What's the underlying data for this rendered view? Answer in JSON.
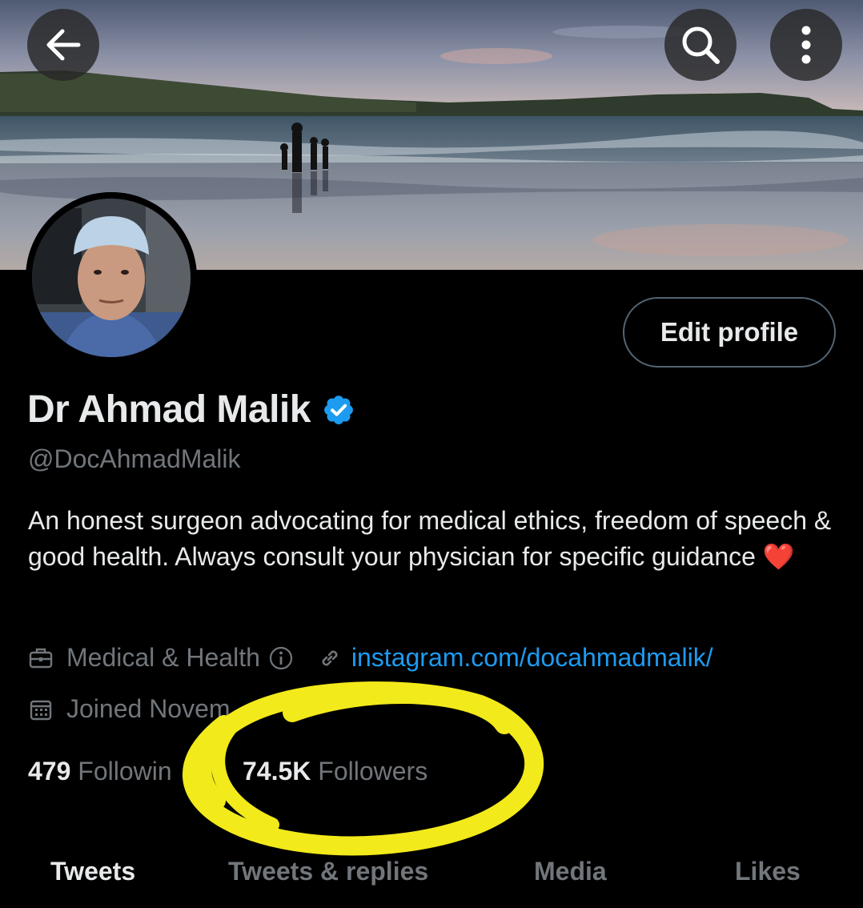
{
  "header": {
    "back_icon": "arrow-left-icon",
    "search_icon": "search-icon",
    "more_icon": "more-vertical-icon"
  },
  "profile": {
    "name": "Dr Ahmad Malik",
    "handle": "@DocAhmadMalik",
    "bio": "An honest surgeon advocating for medical ethics, freedom of speech & good health. Always consult your physician for specific guidance ❤️",
    "edit_label": "Edit profile",
    "category": "Medical & Health",
    "link": "instagram.com/docahmadmalik/",
    "joined": "Joined Novem"
  },
  "stats": {
    "following_count": "479",
    "following_label": "Followin",
    "followers_count": "74.5K",
    "followers_label": "Followers"
  },
  "tabs": [
    {
      "label": "Tweets",
      "active": true
    },
    {
      "label": "Tweets & replies",
      "active": false
    },
    {
      "label": "Media",
      "active": false
    },
    {
      "label": "Likes",
      "active": false
    }
  ],
  "colors": {
    "accent": "#1d9bf0",
    "highlight": "#f2ea1a",
    "muted": "#71767b"
  }
}
